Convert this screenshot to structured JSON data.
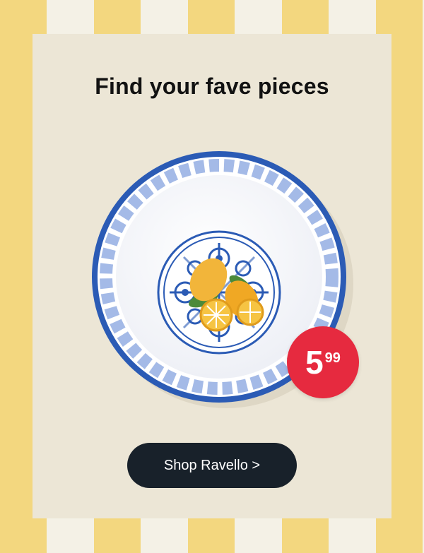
{
  "headline": "Find your fave pieces",
  "price": {
    "main": "5",
    "cents": "99"
  },
  "cta": {
    "label": "Shop Ravello >"
  },
  "colors": {
    "stripe_yellow": "#f3d77f",
    "stripe_cream": "#f4f1e6",
    "card_background": "#ece6d6",
    "plate_rim": "#2b5bb5",
    "price_badge": "#e62a3f",
    "cta_button": "#18212a",
    "lemon": "#f2b53a"
  }
}
